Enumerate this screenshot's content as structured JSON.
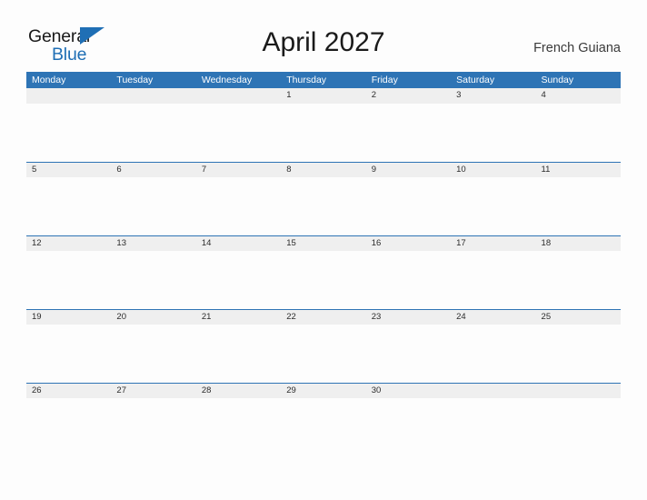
{
  "brand": {
    "name_part1": "General",
    "name_part2": "Blue",
    "flag_icon": "triangle-flag-icon",
    "accent_color": "#1f6fb5"
  },
  "header": {
    "title": "April 2027",
    "location": "French Guiana"
  },
  "colors": {
    "header_bar": "#2e74b5",
    "date_band": "#efefef",
    "separator_line": "#2e74b5",
    "page_background": "#fdfdfd",
    "text_primary": "#1a1a1a"
  },
  "calendar": {
    "month": "April",
    "year": "2027",
    "weekdays": [
      "Monday",
      "Tuesday",
      "Wednesday",
      "Thursday",
      "Friday",
      "Saturday",
      "Sunday"
    ],
    "weeks": [
      [
        "",
        "",
        "",
        "1",
        "2",
        "3",
        "4"
      ],
      [
        "5",
        "6",
        "7",
        "8",
        "9",
        "10",
        "11"
      ],
      [
        "12",
        "13",
        "14",
        "15",
        "16",
        "17",
        "18"
      ],
      [
        "19",
        "20",
        "21",
        "22",
        "23",
        "24",
        "25"
      ],
      [
        "26",
        "27",
        "28",
        "29",
        "30",
        "",
        ""
      ]
    ]
  }
}
